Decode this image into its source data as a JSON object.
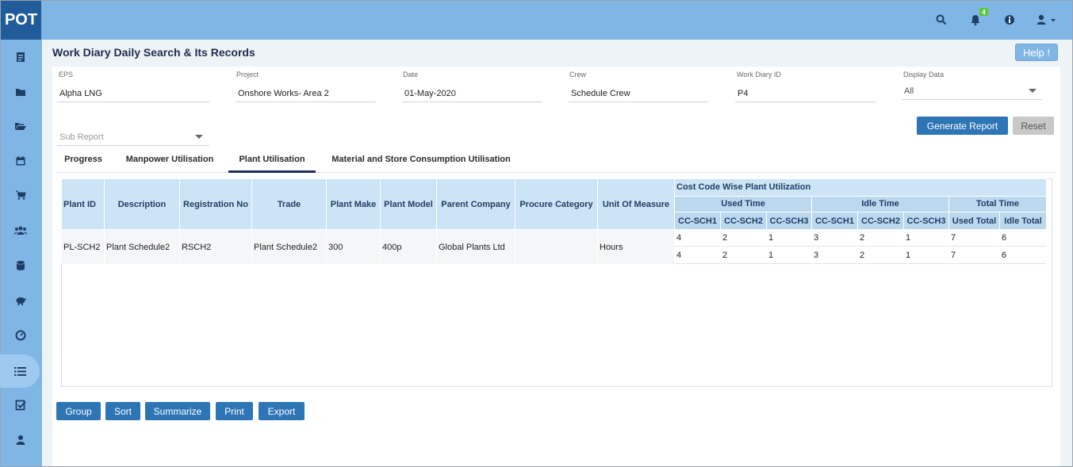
{
  "app": {
    "logo": "POT"
  },
  "topbar": {
    "icons": [
      "search-icon",
      "bell-icon",
      "info-icon",
      "user-icon"
    ],
    "notification_count": "4"
  },
  "sidebar": {
    "items": [
      "report-icon",
      "folder-icon",
      "folder-open-icon",
      "calendar-icon",
      "cart-icon",
      "users-icon",
      "database-icon",
      "piggy-bank-icon",
      "dashboard-icon",
      "list-icon",
      "checklist-icon",
      "user-icon"
    ],
    "active_index": 9
  },
  "page": {
    "title": "Work Diary Daily Search & Its Records",
    "help_label": "Help !"
  },
  "filters": {
    "eps": {
      "label": "EPS",
      "value": "Alpha LNG"
    },
    "project": {
      "label": "Project",
      "value": "Onshore  Works- Area 2"
    },
    "date": {
      "label": "Date",
      "value": "01-May-2020"
    },
    "crew": {
      "label": "Crew",
      "value": "Schedule Crew"
    },
    "work_diary_id": {
      "label": "Work Diary ID",
      "value": "P4"
    },
    "display_data": {
      "label": "Display Data",
      "value": "All"
    },
    "sub_report": {
      "placeholder": "Sub Report"
    }
  },
  "actions": {
    "generate": "Generate Report",
    "reset": "Reset"
  },
  "tabs": [
    {
      "label": "Progress",
      "active": false
    },
    {
      "label": "Manpower Utilisation",
      "active": false
    },
    {
      "label": "Plant Utilisation",
      "active": true
    },
    {
      "label": "Material and Store Consumption Utilisation",
      "active": false
    }
  ],
  "table": {
    "columns": [
      "Plant ID",
      "Description",
      "Registration No",
      "Trade",
      "Plant Make",
      "Plant Model",
      "Parent Company",
      "Procure Category",
      "Unit Of Measure"
    ],
    "group_header": "Cost Code Wise Plant Utilization",
    "groups": [
      "Used Time",
      "Idle Time",
      "Total Time"
    ],
    "sub_columns": [
      "CC-SCH1",
      "CC-SCH2",
      "CC-SCH3",
      "CC-SCH1",
      "CC-SCH2",
      "CC-SCH3",
      "Used Total",
      "Idle Total"
    ],
    "rows": [
      {
        "cells": [
          "PL-SCH2",
          "Plant Schedule2",
          "RSCH2",
          "Plant Schedule2",
          "300",
          "400p",
          "Global Plants Ltd",
          "",
          "Hours"
        ],
        "values": [
          [
            "4",
            "2",
            "1",
            "3",
            "2",
            "1",
            "7",
            "6"
          ],
          [
            "4",
            "2",
            "1",
            "3",
            "2",
            "1",
            "7",
            "6"
          ]
        ]
      }
    ]
  },
  "bottom_buttons": [
    "Group",
    "Sort",
    "Summarize",
    "Print",
    "Export"
  ]
}
